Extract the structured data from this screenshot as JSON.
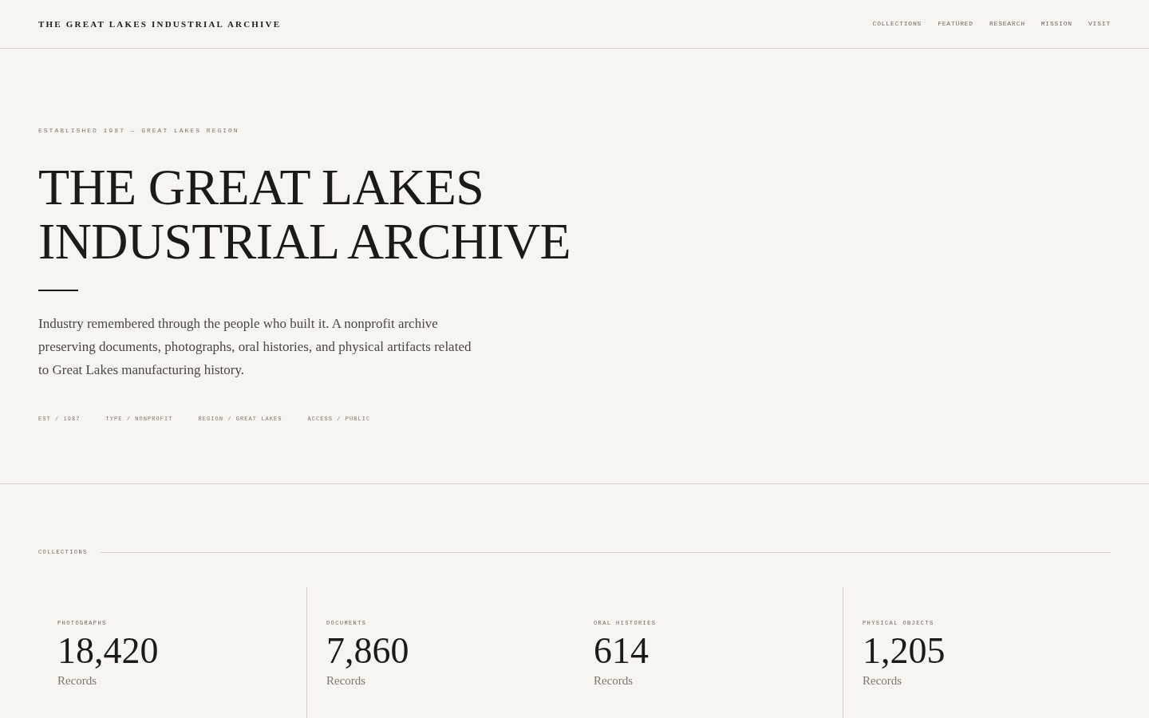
{
  "header": {
    "site_title": "THE GREAT LAKES INDUSTRIAL ARCHIVE",
    "nav": [
      "COLLECTIONS",
      "FEATURED",
      "RESEARCH",
      "MISSION",
      "VISIT"
    ]
  },
  "hero": {
    "eyebrow": "ESTABLISHED 1987 — GREAT LAKES REGION",
    "title_lines": [
      "THE GREAT LAKES",
      "INDUSTRIAL ARCHIVE"
    ],
    "description": "Industry remembered through the people who built it. A nonprofit archive preserving documents, photographs, oral histories, and physical artifacts related to Great Lakes manufacturing history.",
    "facts": [
      "EST / 1987",
      "TYPE / NONPROFIT",
      "REGION / GREAT LAKES",
      "ACCESS / PUBLIC"
    ]
  },
  "collections": {
    "heading": "COLLECTIONS",
    "items": [
      {
        "label": "PHOTOGRAPHS",
        "count": "18,420",
        "unit": "Records"
      },
      {
        "label": "DOCUMENTS",
        "count": "7,860",
        "unit": "Records"
      },
      {
        "label": "ORAL HISTORIES",
        "count": "614",
        "unit": "Records"
      },
      {
        "label": "PHYSICAL OBJECTS",
        "count": "1,205",
        "unit": "Records"
      }
    ]
  }
}
